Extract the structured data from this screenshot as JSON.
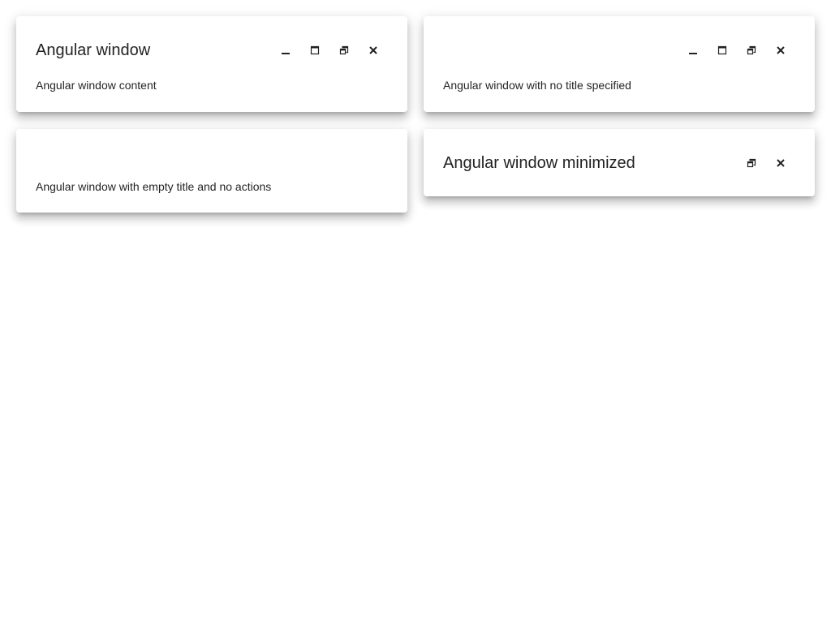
{
  "windows": [
    {
      "title": "Angular window",
      "content": "Angular window content",
      "actions": [
        "minimize",
        "maximize",
        "restore",
        "close"
      ]
    },
    {
      "title": "",
      "content": "Angular window with no title specified",
      "actions": [
        "minimize",
        "maximize",
        "restore",
        "close"
      ]
    },
    {
      "title": "",
      "content": "Angular window with empty title and no actions",
      "actions": []
    },
    {
      "title": "Angular window minimized",
      "content": "",
      "actions": [
        "restore",
        "close"
      ]
    }
  ],
  "icons": {
    "minimize": "minimize-icon",
    "maximize": "maximize-icon",
    "restore": "restore-icon",
    "close": "close-icon"
  },
  "colors": {
    "background": "#ffffff",
    "text": "#212121",
    "icon": "#212121"
  }
}
